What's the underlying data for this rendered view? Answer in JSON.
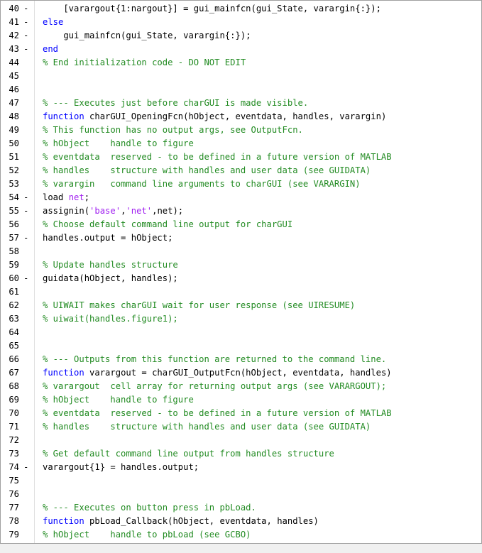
{
  "editor": {
    "lines": [
      {
        "n": "40",
        "mark": "-",
        "tokens": [
          {
            "t": "    [varargout{1:nargout}] = gui_mainfcn(gui_State, varargin{:});",
            "c": "p"
          }
        ]
      },
      {
        "n": "41",
        "mark": "-",
        "tokens": [
          {
            "t": "else",
            "c": "k"
          }
        ]
      },
      {
        "n": "42",
        "mark": "-",
        "tokens": [
          {
            "t": "    gui_mainfcn(gui_State, varargin{:});",
            "c": "p"
          }
        ]
      },
      {
        "n": "43",
        "mark": "-",
        "tokens": [
          {
            "t": "end",
            "c": "k"
          }
        ]
      },
      {
        "n": "44",
        "mark": "",
        "tokens": [
          {
            "t": "% End initialization code - DO NOT EDIT",
            "c": "c"
          }
        ]
      },
      {
        "n": "45",
        "mark": "",
        "tokens": []
      },
      {
        "n": "46",
        "mark": "",
        "tokens": []
      },
      {
        "n": "47",
        "mark": "",
        "tokens": [
          {
            "t": "% --- Executes just before charGUI is made visible.",
            "c": "c"
          }
        ]
      },
      {
        "n": "48",
        "mark": "",
        "tokens": [
          {
            "t": "function",
            "c": "k"
          },
          {
            "t": " charGUI_OpeningFcn(hObject, eventdata, handles, varargin)",
            "c": "p"
          }
        ]
      },
      {
        "n": "49",
        "mark": "",
        "tokens": [
          {
            "t": "% This function has no output args, see OutputFcn.",
            "c": "c"
          }
        ]
      },
      {
        "n": "50",
        "mark": "",
        "tokens": [
          {
            "t": "% hObject    handle to figure",
            "c": "c"
          }
        ]
      },
      {
        "n": "51",
        "mark": "",
        "tokens": [
          {
            "t": "% eventdata  reserved - to be defined in a future version of MATLAB",
            "c": "c"
          }
        ]
      },
      {
        "n": "52",
        "mark": "",
        "tokens": [
          {
            "t": "% handles    structure with handles and user data (see GUIDATA)",
            "c": "c"
          }
        ]
      },
      {
        "n": "53",
        "mark": "",
        "tokens": [
          {
            "t": "% varargin   command line arguments to charGUI (see VARARGIN)",
            "c": "c"
          }
        ]
      },
      {
        "n": "54",
        "mark": "-",
        "tokens": [
          {
            "t": "load ",
            "c": "p"
          },
          {
            "t": "net",
            "c": "s"
          },
          {
            "t": ";",
            "c": "p"
          }
        ]
      },
      {
        "n": "55",
        "mark": "-",
        "tokens": [
          {
            "t": "assignin(",
            "c": "p"
          },
          {
            "t": "'base'",
            "c": "s"
          },
          {
            "t": ",",
            "c": "p"
          },
          {
            "t": "'net'",
            "c": "s"
          },
          {
            "t": ",net);",
            "c": "p"
          }
        ]
      },
      {
        "n": "56",
        "mark": "",
        "tokens": [
          {
            "t": "% Choose default command line output for charGUI",
            "c": "c"
          }
        ]
      },
      {
        "n": "57",
        "mark": "-",
        "tokens": [
          {
            "t": "handles.output = hObject;",
            "c": "p"
          }
        ]
      },
      {
        "n": "58",
        "mark": "",
        "tokens": []
      },
      {
        "n": "59",
        "mark": "",
        "tokens": [
          {
            "t": "% Update handles structure",
            "c": "c"
          }
        ]
      },
      {
        "n": "60",
        "mark": "-",
        "tokens": [
          {
            "t": "guidata(hObject, handles);",
            "c": "p"
          }
        ]
      },
      {
        "n": "61",
        "mark": "",
        "tokens": []
      },
      {
        "n": "62",
        "mark": "",
        "tokens": [
          {
            "t": "% UIWAIT makes charGUI wait for user response (see UIRESUME)",
            "c": "c"
          }
        ]
      },
      {
        "n": "63",
        "mark": "",
        "tokens": [
          {
            "t": "% uiwait(handles.figure1);",
            "c": "c"
          }
        ]
      },
      {
        "n": "64",
        "mark": "",
        "tokens": []
      },
      {
        "n": "65",
        "mark": "",
        "tokens": []
      },
      {
        "n": "66",
        "mark": "",
        "tokens": [
          {
            "t": "% --- Outputs from this function are returned to the command line.",
            "c": "c"
          }
        ]
      },
      {
        "n": "67",
        "mark": "",
        "tokens": [
          {
            "t": "function",
            "c": "k"
          },
          {
            "t": " varargout = charGUI_OutputFcn(hObject, eventdata, handles)",
            "c": "p"
          }
        ]
      },
      {
        "n": "68",
        "mark": "",
        "tokens": [
          {
            "t": "% varargout  cell array for returning output args (see VARARGOUT);",
            "c": "c"
          }
        ]
      },
      {
        "n": "69",
        "mark": "",
        "tokens": [
          {
            "t": "% hObject    handle to figure",
            "c": "c"
          }
        ]
      },
      {
        "n": "70",
        "mark": "",
        "tokens": [
          {
            "t": "% eventdata  reserved - to be defined in a future version of MATLAB",
            "c": "c"
          }
        ]
      },
      {
        "n": "71",
        "mark": "",
        "tokens": [
          {
            "t": "% handles    structure with handles and user data (see GUIDATA)",
            "c": "c"
          }
        ]
      },
      {
        "n": "72",
        "mark": "",
        "tokens": []
      },
      {
        "n": "73",
        "mark": "",
        "tokens": [
          {
            "t": "% Get default command line output from handles structure",
            "c": "c"
          }
        ]
      },
      {
        "n": "74",
        "mark": "-",
        "tokens": [
          {
            "t": "varargout{1} = handles.output;",
            "c": "p"
          }
        ]
      },
      {
        "n": "75",
        "mark": "",
        "tokens": []
      },
      {
        "n": "76",
        "mark": "",
        "tokens": []
      },
      {
        "n": "77",
        "mark": "",
        "tokens": [
          {
            "t": "% --- Executes on button press in pbLoad.",
            "c": "c"
          }
        ]
      },
      {
        "n": "78",
        "mark": "",
        "tokens": [
          {
            "t": "function",
            "c": "k"
          },
          {
            "t": " pbLoad_Callback(hObject, eventdata, handles)",
            "c": "p"
          }
        ]
      },
      {
        "n": "79",
        "mark": "",
        "tokens": [
          {
            "t": "% hObject    handle to pbLoad (see GCBO)",
            "c": "c"
          }
        ]
      }
    ]
  },
  "colors": {
    "keyword": "#0000ff",
    "comment": "#228b22",
    "string": "#a020f0",
    "plain": "#000000"
  }
}
